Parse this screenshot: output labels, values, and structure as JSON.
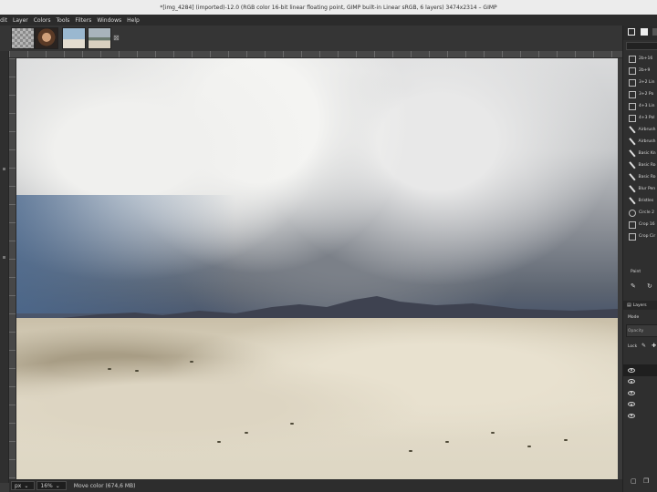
{
  "window": {
    "title": "*[img_4284] (imported)-12.0 (RGB color 16-bit linear floating point, GIMP built-in Linear sRGB, 6 layers) 3474x2314 – GIMP"
  },
  "menu": [
    "Edit",
    "Layer",
    "Colors",
    "Tools",
    "Filters",
    "Windows",
    "Help"
  ],
  "status": {
    "unit": "px",
    "zoom": "16%",
    "message": "Move color (674,6 MB)"
  },
  "brushes": {
    "items": [
      "2b+16",
      "2b+9",
      "3+2 Lin",
      "3+2 Po",
      "4+3 Lin",
      "4+3 Pol",
      "Airbrush",
      "Airbrush",
      "Basic Kn",
      "Basic Ro",
      "Basic Ro",
      "Blur Pen",
      "Bristles",
      "Circle 2",
      "Crop 16",
      "Crop Cir"
    ],
    "footer": "Paint"
  },
  "layers": {
    "tab": "Layers",
    "mode_label": "Mode",
    "opacity_label": "Opacity",
    "lock_label": "Lock"
  },
  "colors": {
    "titlebar": "#ececec",
    "menubar": "#2b2b2b",
    "dock": "#2f2f2f"
  }
}
